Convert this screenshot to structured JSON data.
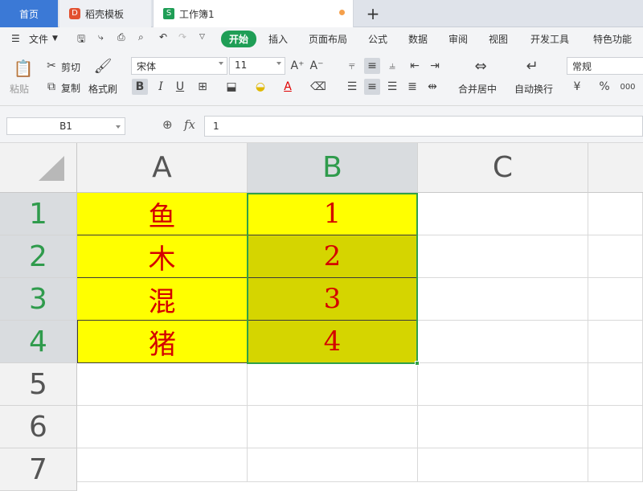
{
  "tabs": {
    "home": "首页",
    "template": "稻壳模板",
    "doc_badge": "S",
    "document": "工作簿1",
    "add": "+"
  },
  "menu": {
    "file": "文件",
    "items": [
      "开始",
      "插入",
      "页面布局",
      "公式",
      "数据",
      "审阅",
      "视图",
      "开发工具",
      "特色功能"
    ]
  },
  "ribbon": {
    "paste": "粘贴",
    "cut": "剪切",
    "copy": "复制",
    "format_painter": "格式刷",
    "font_name": "宋体",
    "font_size": "11",
    "merge_center": "合并居中",
    "wrap_text": "自动换行",
    "number_format": "常规",
    "currency_symbol": "¥",
    "percent_symbol": "%",
    "thousands": "000",
    "bold": "B",
    "italic": "I",
    "underline": "U",
    "font_color_letter": "A",
    "grow_font": "A⁺",
    "shrink_font": "A⁻"
  },
  "formula_bar": {
    "name_box": "B1",
    "fx": "fx",
    "value": "1"
  },
  "columns": [
    "A",
    "B",
    "C"
  ],
  "rows": [
    "1",
    "2",
    "3",
    "4",
    "5",
    "6",
    "7"
  ],
  "cells": {
    "A": [
      "鱼",
      "木",
      "混",
      "猪"
    ],
    "B": [
      "1",
      "2",
      "3",
      "4"
    ]
  },
  "colors": {
    "accent_green": "#2fa149",
    "tab_blue": "#3b79d6",
    "cell_yellow": "#ffff00",
    "cell_selected_yellow": "#d5d500",
    "cell_text_red": "#d40000"
  }
}
